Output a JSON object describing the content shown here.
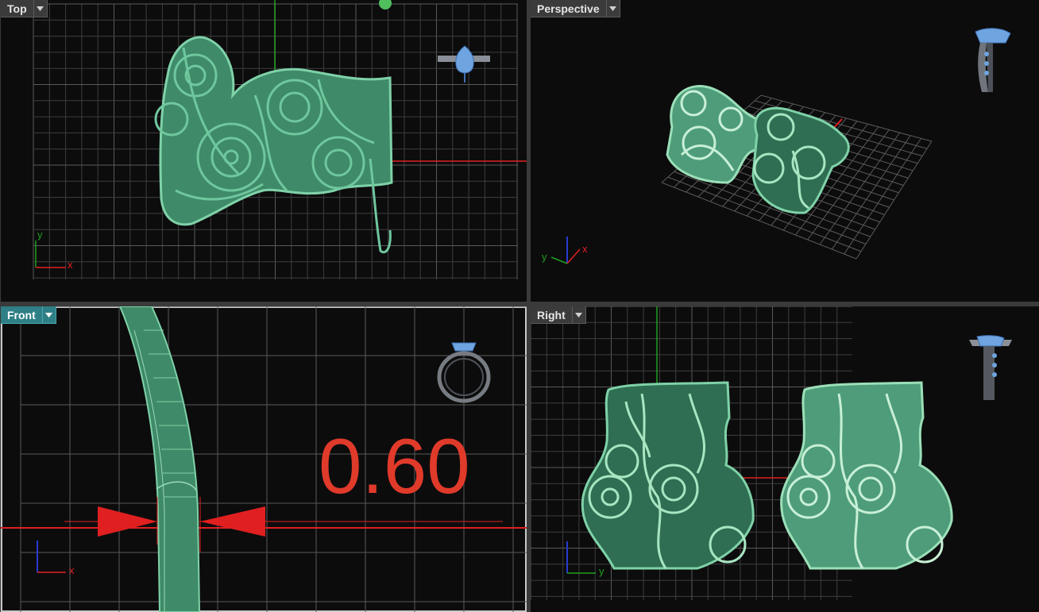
{
  "viewports": {
    "top": {
      "name": "Top"
    },
    "perspective": {
      "name": "Perspective"
    },
    "front": {
      "name": "Front"
    },
    "right": {
      "name": "Right"
    }
  },
  "axes": {
    "top": {
      "a": "y",
      "b": "x"
    },
    "perspective": {
      "a": "y",
      "b": "x"
    },
    "front": {
      "b": "x"
    },
    "right": {
      "b": "y"
    }
  },
  "dimension": {
    "value": "0.60"
  },
  "colors": {
    "background": "#0c0c0d",
    "grid": "#3e3e3e",
    "grid_major": "#5a5a5a",
    "model": "#4e9c7a",
    "model_outline": "#7fd2a8",
    "gem": "#6ea4e0",
    "axis_x": "#e02020",
    "axis_y": "#1fa01f",
    "axis_z": "#2a3ad0",
    "dimension": "#e03a2a",
    "active_tab": "#2f7f86"
  }
}
